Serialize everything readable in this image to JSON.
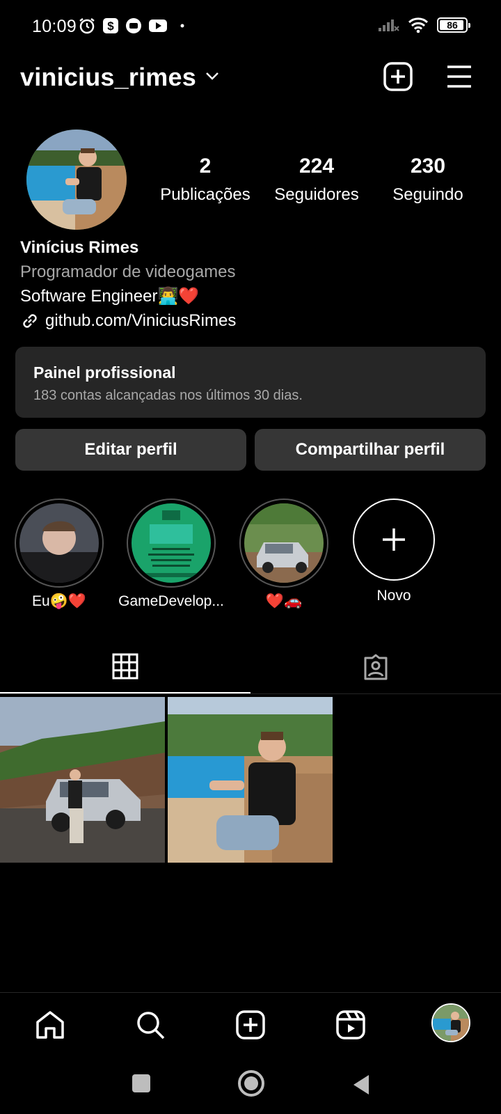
{
  "status_bar": {
    "time": "10:09",
    "battery": "86",
    "left_icons": [
      "alarm-icon",
      "dollar-app-icon",
      "messenger-app-icon",
      "youtube-icon",
      "dot-icon"
    ],
    "right_icons": [
      "signal-icon",
      "wifi-icon",
      "battery-icon"
    ]
  },
  "header": {
    "username": "vinicius_rimes",
    "icons": [
      "chevron-down-icon",
      "add-post-icon",
      "menu-icon"
    ]
  },
  "profile": {
    "stats": {
      "posts_count": "2",
      "posts_label": "Publicações",
      "followers_count": "224",
      "followers_label": "Seguidores",
      "following_count": "230",
      "following_label": "Seguindo"
    },
    "name": "Vinícius Rimes",
    "category": "Programador de videogames",
    "bio": "Software Engineer👨‍💻❤️",
    "link": "github.com/ViniciusRimes"
  },
  "dashboard": {
    "title": "Painel profissional",
    "subtitle": "183 contas alcançadas nos últimos 30 dias."
  },
  "buttons": {
    "edit": "Editar perfil",
    "share": "Compartilhar perfil"
  },
  "highlights": [
    {
      "label": "Eu🤪❤️"
    },
    {
      "label": "GameDevelop..."
    },
    {
      "label": "❤️🚗"
    }
  ],
  "new_highlight_label": "Novo",
  "tabs": [
    "grid-icon",
    "tagged-icon"
  ],
  "bottom_nav": [
    "home-icon",
    "search-icon",
    "create-icon",
    "reels-icon",
    "profile-avatar"
  ],
  "colors": {
    "background": "#000000",
    "card": "#262626",
    "button": "#363636",
    "secondary_text": "#a8a8a8"
  }
}
